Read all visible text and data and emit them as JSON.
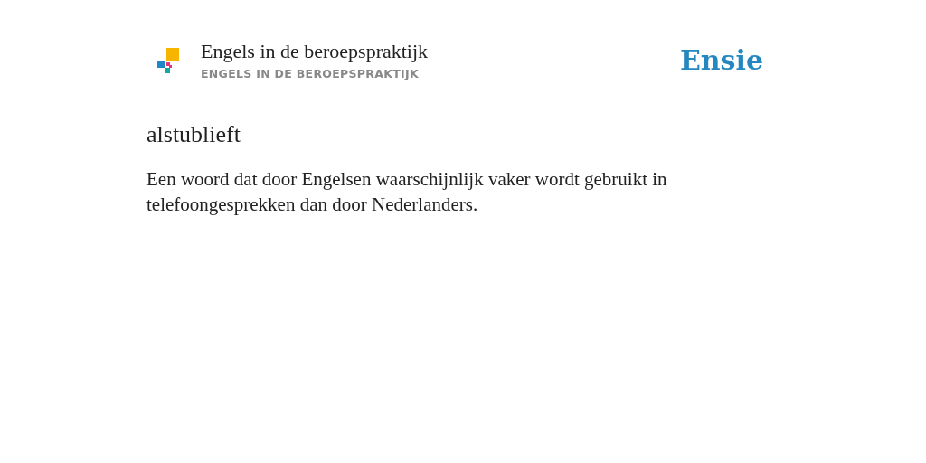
{
  "header": {
    "title": "Engels in de beroepspraktijk",
    "subtitle": "ENGELS IN DE BEROEPSPRAKTIJK",
    "brand": "Ensie"
  },
  "entry": {
    "term": "alstublieft",
    "definition": "Een woord dat door Engelsen waarschijnlijk vaker wordt gebruikt in telefoongesprekken dan door Nederlanders."
  }
}
